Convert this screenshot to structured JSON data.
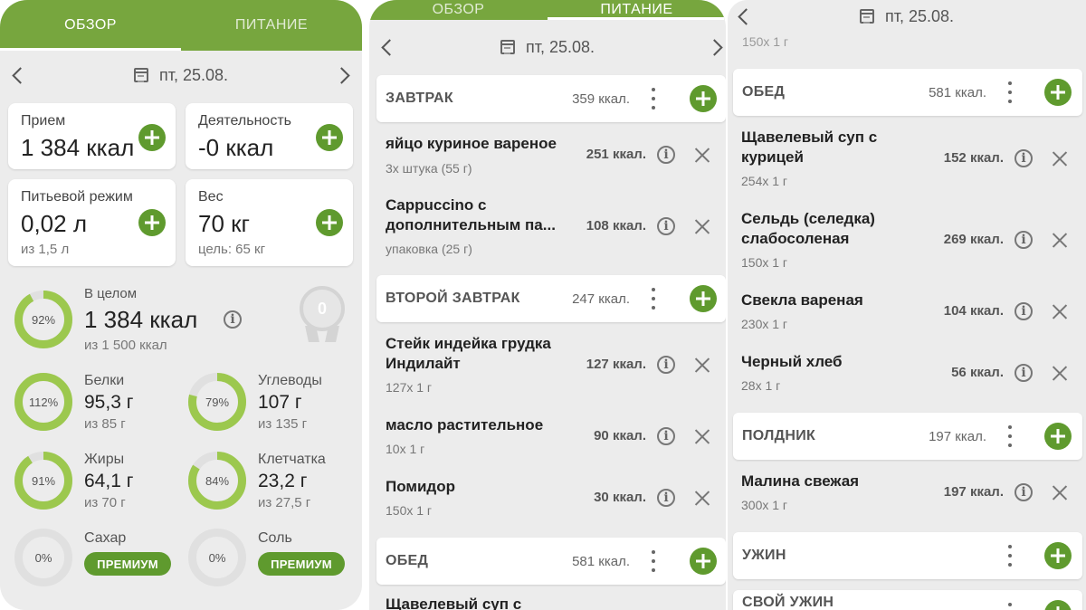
{
  "panel1": {
    "tabs": [
      "ОБЗОР",
      "ПИТАНИЕ"
    ],
    "date": "пт, 25.08.",
    "cards": [
      {
        "title": "Прием",
        "value": "1 384 ккал"
      },
      {
        "title": "Деятельность",
        "value": "-0 ккал"
      },
      {
        "title": "Питьевой режим",
        "value": "0,02 л",
        "sub": "из 1,5 л"
      },
      {
        "title": "Вес",
        "value": "70 кг",
        "sub": "цель: 65 кг"
      }
    ],
    "overall": {
      "label": "В целом",
      "value": "1 384 ккал",
      "sub": "из 1 500 ккал",
      "percent": 92,
      "percent_label": "92%"
    },
    "medal": "0",
    "nutrients": [
      {
        "name": "Белки",
        "value": "95,3 г",
        "sub": "из 85 г",
        "percent": 112,
        "percent_label": "112%"
      },
      {
        "name": "Углеводы",
        "value": "107 г",
        "sub": "из 135 г",
        "percent": 79,
        "percent_label": "79%"
      },
      {
        "name": "Жиры",
        "value": "64,1 г",
        "sub": "из 70 г",
        "percent": 91,
        "percent_label": "91%"
      },
      {
        "name": "Клетчатка",
        "value": "23,2 г",
        "sub": "из 27,5 г",
        "percent": 84,
        "percent_label": "84%"
      },
      {
        "name": "Сахар",
        "percent": 0,
        "percent_label": "0%",
        "badge": "ПРЕМИУМ"
      },
      {
        "name": "Соль",
        "percent": 0,
        "percent_label": "0%",
        "badge": "ПРЕМИУМ"
      }
    ]
  },
  "panel2": {
    "tabs": [
      "ОБЗОР",
      "ПИТАНИЕ"
    ],
    "date": "пт, 25.08.",
    "meals": [
      {
        "name": "ЗАВТРАК",
        "kcal": "359 ккал."
      },
      {
        "name": "ВТОРОЙ ЗАВТРАК",
        "kcal": "247 ккал."
      },
      {
        "name": "ОБЕД",
        "kcal": "581 ккал."
      }
    ],
    "foods": [
      {
        "name": "яйцо куриное вареное",
        "qty": "3x штука (55 г)",
        "kcal": "251 ккал."
      },
      {
        "name": "Cappuccino с дополнительным па...",
        "qty": "упаковка (25 г)",
        "kcal": "108 ккал."
      },
      {
        "name": "Стейк индейка грудка Индилайт",
        "qty": "127x 1 г",
        "kcal": "127 ккал."
      },
      {
        "name": "масло растительное",
        "qty": "10x 1 г",
        "kcal": "90 ккал."
      },
      {
        "name": "Помидор",
        "qty": "150x 1 г",
        "kcal": "30 ккал."
      },
      {
        "name": "Щавелевый суп с"
      }
    ]
  },
  "panel3": {
    "date": "пт, 25.08.",
    "top_qty": "150x 1 г",
    "meals": [
      {
        "name": "ОБЕД",
        "kcal": "581 ккал."
      },
      {
        "name": "ПОЛДНИК",
        "kcal": "197 ккал."
      },
      {
        "name": "УЖИН"
      },
      {
        "name": "СВОЙ УЖИН"
      }
    ],
    "foods": [
      {
        "name": "Щавелевый суп с курицей",
        "qty": "254x 1 г",
        "kcal": "152 ккал."
      },
      {
        "name": "Сельдь (селедка) слабосоленая",
        "qty": "150x 1 г",
        "kcal": "269 ккал."
      },
      {
        "name": "Свекла вареная",
        "qty": "230x 1 г",
        "kcal": "104 ккал."
      },
      {
        "name": "Черный хлеб",
        "qty": "28x 1 г",
        "kcal": "56 ккал."
      },
      {
        "name": "Малина свежая",
        "qty": "300x 1 г",
        "kcal": "197 ккал."
      }
    ]
  },
  "colors": {
    "accent": "#77a63e",
    "button": "#5f9a2e",
    "ring_track": "#e0e0e0",
    "ring_fill": "#9cc84e"
  }
}
